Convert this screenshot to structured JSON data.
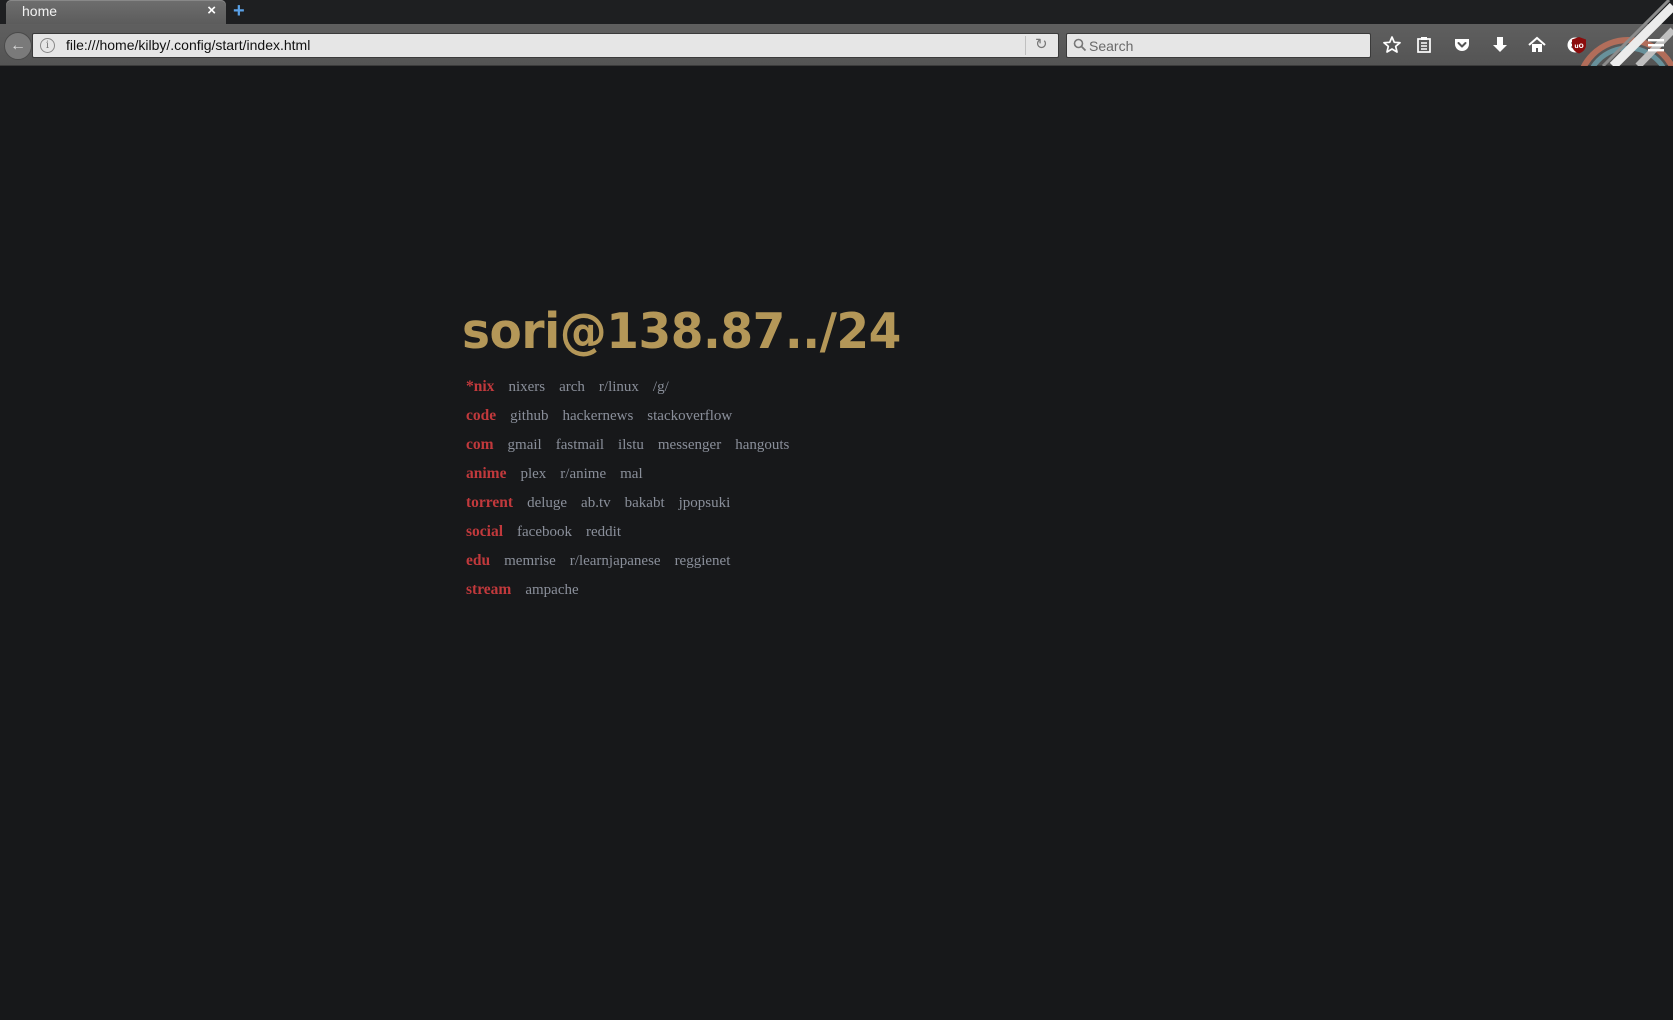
{
  "browser": {
    "tab": {
      "title": "home",
      "close_glyph": "×"
    },
    "new_tab_glyph": "+",
    "back_glyph": "←",
    "url": "file:///home/kilby/.config/start/index.html",
    "search_placeholder": "Search",
    "toolbar_icons": [
      "bookmark-star-icon",
      "reading-list-icon",
      "pocket-icon",
      "download-icon",
      "home-icon",
      "smiley-icon",
      "ublock-icon",
      "menu-icon"
    ]
  },
  "page": {
    "heading": "sori@138.87../24",
    "categories": [
      {
        "name": "*nix",
        "links": [
          "nixers",
          "arch",
          "r/linux",
          "/g/"
        ]
      },
      {
        "name": "code",
        "links": [
          "github",
          "hackernews",
          "stackoverflow"
        ]
      },
      {
        "name": "com",
        "links": [
          "gmail",
          "fastmail",
          "ilstu",
          "messenger",
          "hangouts"
        ]
      },
      {
        "name": "anime",
        "links": [
          "plex",
          "r/anime",
          "mal"
        ]
      },
      {
        "name": "torrent",
        "links": [
          "deluge",
          "ab.tv",
          "bakabt",
          "jpopsuki"
        ]
      },
      {
        "name": "social",
        "links": [
          "facebook",
          "reddit"
        ]
      },
      {
        "name": "edu",
        "links": [
          "memrise",
          "r/learnjapanese",
          "reggienet"
        ]
      },
      {
        "name": "stream",
        "links": [
          "ampache"
        ]
      }
    ]
  },
  "colors": {
    "background": "#17181a",
    "heading": "#b49758",
    "category": "#c1393c",
    "link": "#8a8f9a"
  }
}
